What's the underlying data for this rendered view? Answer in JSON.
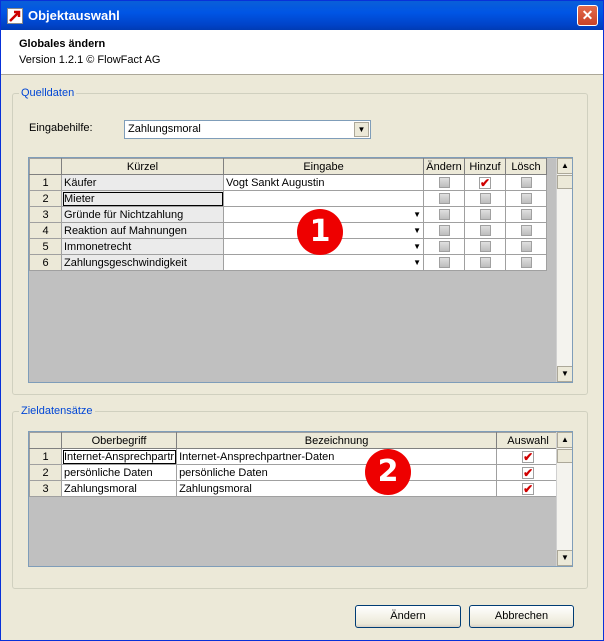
{
  "window": {
    "title": "Objektauswahl",
    "close_label": "✕"
  },
  "header": {
    "title": "Globales ändern",
    "version": "Version 1.2.1 © FlowFact AG"
  },
  "quelldaten": {
    "legend": "Quelldaten",
    "eingabehilfe_label": "Eingabehilfe:",
    "eingabehilfe_value": "Zahlungsmoral",
    "columns": [
      "Kürzel",
      "Eingabe",
      "Ändern",
      "Hinzuf",
      "Lösch"
    ],
    "rows": [
      {
        "num": "1",
        "kuerzel": "Käufer",
        "eingabe": "Vogt Sankt Augustin",
        "aendern": false,
        "hinzuf": true,
        "loesch": false
      },
      {
        "num": "2",
        "kuerzel": "Mieter",
        "eingabe": "",
        "aendern": false,
        "hinzuf": false,
        "loesch": false
      },
      {
        "num": "3",
        "kuerzel": "Gründe für Nichtzahlung",
        "eingabe": "",
        "aendern": false,
        "hinzuf": false,
        "loesch": false
      },
      {
        "num": "4",
        "kuerzel": "Reaktion auf Mahnungen",
        "eingabe": "",
        "aendern": false,
        "hinzuf": false,
        "loesch": false
      },
      {
        "num": "5",
        "kuerzel": "Immonetrecht",
        "eingabe": "",
        "aendern": false,
        "hinzuf": false,
        "loesch": false
      },
      {
        "num": "6",
        "kuerzel": "Zahlungsgeschwindigkeit",
        "eingabe": "",
        "aendern": false,
        "hinzuf": false,
        "loesch": false
      }
    ],
    "marker": "1"
  },
  "zieldatensaetze": {
    "legend": "Zieldatensätze",
    "columns": [
      "Oberbegriff",
      "Bezeichnung",
      "Auswahl"
    ],
    "rows": [
      {
        "num": "1",
        "oberbegriff": "Internet-Ansprechpartr",
        "bezeichnung": "Internet-Ansprechpartner-Daten",
        "auswahl": true
      },
      {
        "num": "2",
        "oberbegriff": "persönliche Daten",
        "bezeichnung": "persönliche Daten",
        "auswahl": true
      },
      {
        "num": "3",
        "oberbegriff": "Zahlungsmoral",
        "bezeichnung": "Zahlungsmoral",
        "auswahl": true
      }
    ],
    "marker": "2"
  },
  "buttons": {
    "aendern": "Ändern",
    "abbrechen": "Abbrechen"
  },
  "colors": {
    "title_bar": "#0055e5",
    "marker": "#ee0000",
    "check": "#d00000"
  }
}
